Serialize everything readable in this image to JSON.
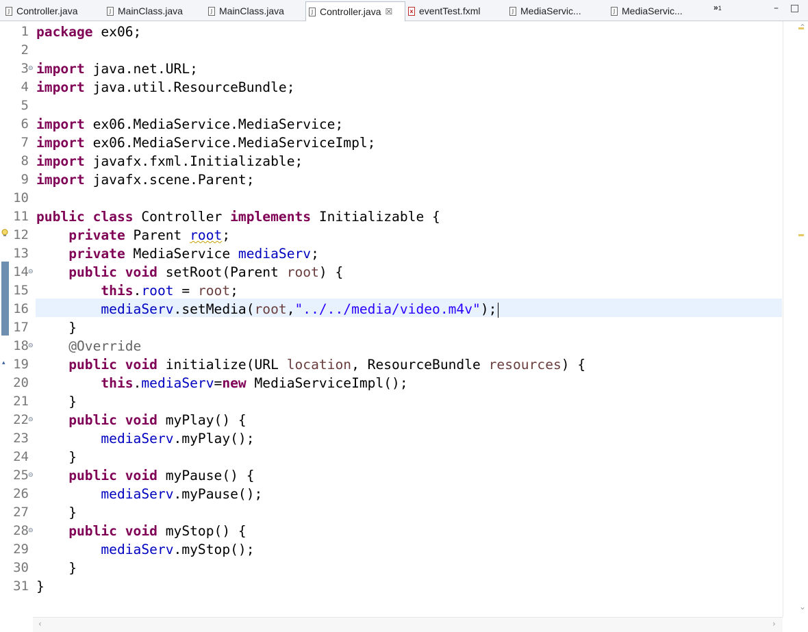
{
  "tabs": [
    {
      "label": "Controller.java",
      "icon": "java-file-icon"
    },
    {
      "label": "MainClass.java",
      "icon": "java-file-icon"
    },
    {
      "label": "MainClass.java",
      "icon": "java-file-icon"
    },
    {
      "label": "Controller.java",
      "icon": "java-file-icon",
      "active": true,
      "close": "☒"
    },
    {
      "label": "eventTest.fxml",
      "icon": "fxml-file-icon"
    },
    {
      "label": "MediaServic...",
      "icon": "java-file-icon"
    },
    {
      "label": "MediaServic...",
      "icon": "java-file-icon"
    }
  ],
  "overflow": {
    "label": "»",
    "count": "1"
  },
  "window": {
    "minimize": "–",
    "maximize": "□"
  },
  "line_numbers": [
    "1",
    "2",
    "3",
    "4",
    "5",
    "6",
    "7",
    "8",
    "9",
    "10",
    "11",
    "12",
    "13",
    "14",
    "15",
    "16",
    "17",
    "18",
    "19",
    "20",
    "21",
    "22",
    "23",
    "24",
    "25",
    "26",
    "27",
    "28",
    "29",
    "30",
    "31"
  ],
  "code": {
    "l1_kw": "package",
    "l1_rest": " ex06;",
    "l3_kw": "import",
    "l3_rest": " java.net.URL;",
    "l4_kw": "import",
    "l4_rest": " java.util.ResourceBundle;",
    "l6_kw": "import",
    "l6_rest": " ex06.MediaService.MediaService;",
    "l7_kw": "import",
    "l7_rest": " ex06.MediaService.MediaServiceImpl;",
    "l8_kw": "import",
    "l8_rest": " javafx.fxml.Initializable;",
    "l9_kw": "import",
    "l9_rest": " javafx.scene.Parent;",
    "l11_kw1": "public",
    "l11_kw2": "class",
    "l11_t1": " Controller ",
    "l11_kw3": "implements",
    "l11_t2": " Initializable {",
    "l12_kw": "private",
    "l12_t1": " Parent ",
    "l12_fld": "root",
    "l12_t2": ";",
    "l13_kw": "private",
    "l13_t1": " MediaService ",
    "l13_fld": "mediaServ",
    "l13_t2": ";",
    "l14_kw1": "public",
    "l14_kw2": "void",
    "l14_t1": " setRoot(Parent ",
    "l14_prm": "root",
    "l14_t2": ") {",
    "l15_kw": "this",
    "l15_t1": ".",
    "l15_fld": "root",
    "l15_t2": " = ",
    "l15_prm": "root",
    "l15_t3": ";",
    "l16_fld": "mediaServ",
    "l16_t1": ".setMedia(",
    "l16_prm": "root",
    "l16_t2": ",",
    "l16_str": "\"../../media/video.m4v\"",
    "l16_t3": ");",
    "l17": "}",
    "l18_ann": "@Override",
    "l19_kw1": "public",
    "l19_kw2": "void",
    "l19_t1": " initialize(URL ",
    "l19_prm1": "location",
    "l19_t2": ", ResourceBundle ",
    "l19_prm2": "resources",
    "l19_t3": ") {",
    "l20_kw1": "this",
    "l20_t1": ".",
    "l20_fld": "mediaServ",
    "l20_t2": "=",
    "l20_kw2": "new",
    "l20_t3": " MediaServiceImpl();",
    "l21": "}",
    "l22_kw1": "public",
    "l22_kw2": "void",
    "l22_t1": " myPlay() {",
    "l23_fld": "mediaServ",
    "l23_t1": ".myPlay();",
    "l24": "}",
    "l25_kw1": "public",
    "l25_kw2": "void",
    "l25_t1": " myPause() {",
    "l26_fld": "mediaServ",
    "l26_t1": ".myPause();",
    "l27": "}",
    "l28_kw1": "public",
    "l28_kw2": "void",
    "l28_t1": " myStop() {",
    "l29_fld": "mediaServ",
    "l29_t1": ".myStop();",
    "l30": "}",
    "l31": "}"
  },
  "colors": {
    "keyword": "#7f0055",
    "field": "#0000c0",
    "param": "#6a3e3e",
    "string": "#2a00ff",
    "annotation": "#646464",
    "current_line": "#e8f2fe"
  }
}
